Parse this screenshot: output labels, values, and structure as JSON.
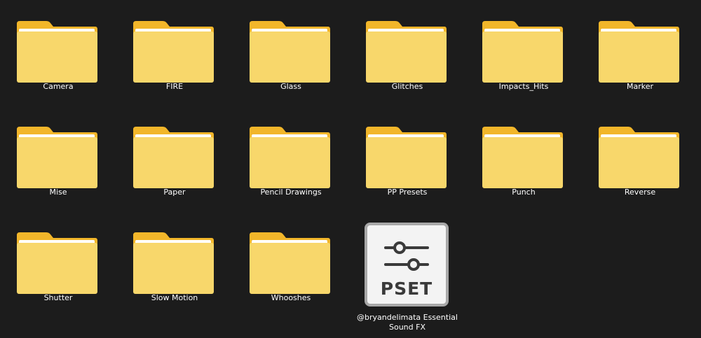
{
  "folders": [
    {
      "label": "Camera"
    },
    {
      "label": "FIRE"
    },
    {
      "label": "Glass"
    },
    {
      "label": "Glitches"
    },
    {
      "label": "Impacts_Hits"
    },
    {
      "label": "Marker"
    },
    {
      "label": "Mise"
    },
    {
      "label": "Paper"
    },
    {
      "label": "Pencil Drawings"
    },
    {
      "label": "PP Presets"
    },
    {
      "label": "Punch"
    },
    {
      "label": "Reverse"
    },
    {
      "label": "Shutter"
    },
    {
      "label": "Slow Motion"
    },
    {
      "label": "Whooshes"
    }
  ],
  "pset_file": {
    "icon_text": "PSET",
    "label": "@bryandelimata Essential Sound FX",
    "icon": "sliders-icon"
  },
  "colors": {
    "background": "#1c1c1c",
    "folder_front": "#f8d76b",
    "folder_back": "#f2b62a",
    "folder_paper": "#ffffff"
  }
}
